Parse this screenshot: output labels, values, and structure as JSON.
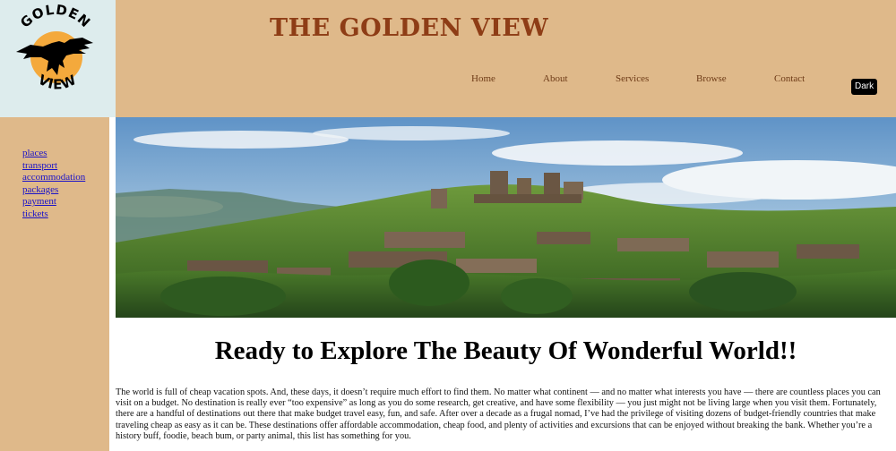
{
  "logo": {
    "top_text": "GOLDEN",
    "bottom_text": "VIEW",
    "sun_color": "#f4a93c",
    "bird_color": "#000000",
    "icon": "eagle-over-sun-icon"
  },
  "header": {
    "title": "THE GOLDEN VIEW",
    "nav": [
      "Home",
      "About",
      "Services",
      "Browse",
      "Contact"
    ],
    "theme_toggle_label": "Dark"
  },
  "sidebar": {
    "links": [
      "places",
      "transport",
      "accommodation",
      "packages",
      "payment",
      "tickets"
    ]
  },
  "hero": {
    "image_subject": "green hillside village with stone towers under a blue sky"
  },
  "main": {
    "headline": "Ready to Explore The Beauty Of Wonderful World!!",
    "intro": "The world is full of cheap vacation spots. And, these days, it doesn’t require much effort to find them. No matter what continent — and no matter what interests you have — there are countless places you can visit on a budget. No destination is really ever “too expensive” as long as you do some research, get creative, and have some flexibility — you just might not be living large when you visit them. Fortunately, there are a handful of destinations out there that make budget travel easy, fun, and safe. After over a decade as a frugal nomad, I’ve had the privilege of visiting dozens of budget-friendly countries that make traveling cheap as easy as it can be. These destinations offer affordable accommodation, cheap food, and plenty of activities and excursions that can be enjoyed without breaking the bank. Whether you’re a history buff, foodie, beach bum, or party animal, this list has something for you."
  },
  "colors": {
    "header_bg": "#dfb98a",
    "logo_bg": "#ddeced",
    "title": "#8e3d16",
    "nav_text": "#6e3b17",
    "sidebar_link": "#1a12c8"
  }
}
